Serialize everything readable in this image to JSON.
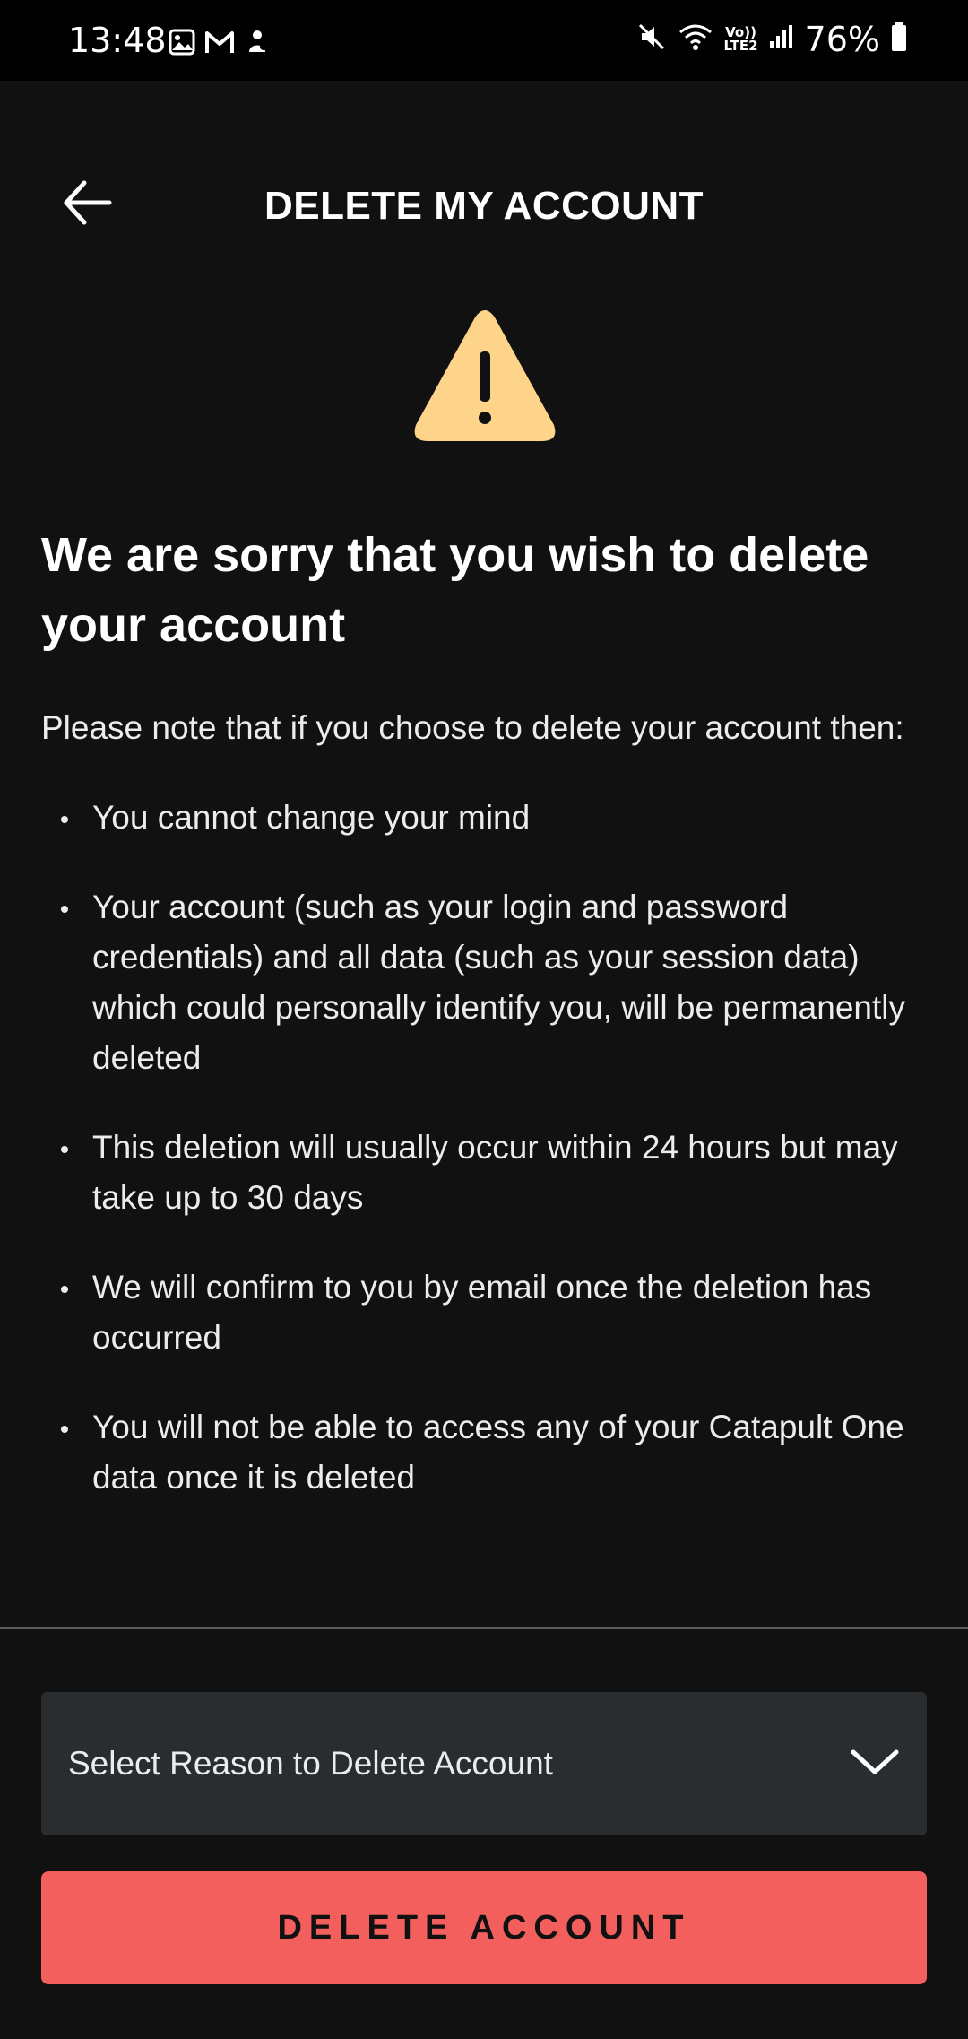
{
  "status_bar": {
    "time": "13:48",
    "battery": "76%",
    "network_line1": "Vo))",
    "network_line2": "LTE2",
    "left_icons": [
      "gallery-icon",
      "gmail-icon",
      "notification-icon"
    ],
    "right_icons": [
      "mute-icon",
      "wifi-icon",
      "signal-icon",
      "battery-icon"
    ]
  },
  "header": {
    "title": "DELETE MY ACCOUNT",
    "back_icon": "arrow-left-icon"
  },
  "warning": {
    "icon": "warning-triangle-icon",
    "color": "#fdd48a"
  },
  "content": {
    "headline": "We are sorry that you wish to delete your account",
    "intro": "Please note that if you choose to delete your account then:",
    "bullets": [
      "You cannot change your mind",
      "Your account (such as your login and password credentials) and all data (such as your session data) which could personally identify you, will be permanently deleted",
      "This deletion will usually occur within 24 hours but may take up to 30 days",
      "We will confirm to you by email once the deletion has occurred",
      "You will not be able to access any of your Catapult One data once it is deleted"
    ]
  },
  "form": {
    "reason_placeholder": "Select Reason to Delete Account",
    "dropdown_icon": "chevron-down-icon",
    "delete_label": "DELETE ACCOUNT"
  },
  "colors": {
    "background": "#111111",
    "accent_red": "#f25f5c",
    "select_bg": "#2a2d30"
  }
}
